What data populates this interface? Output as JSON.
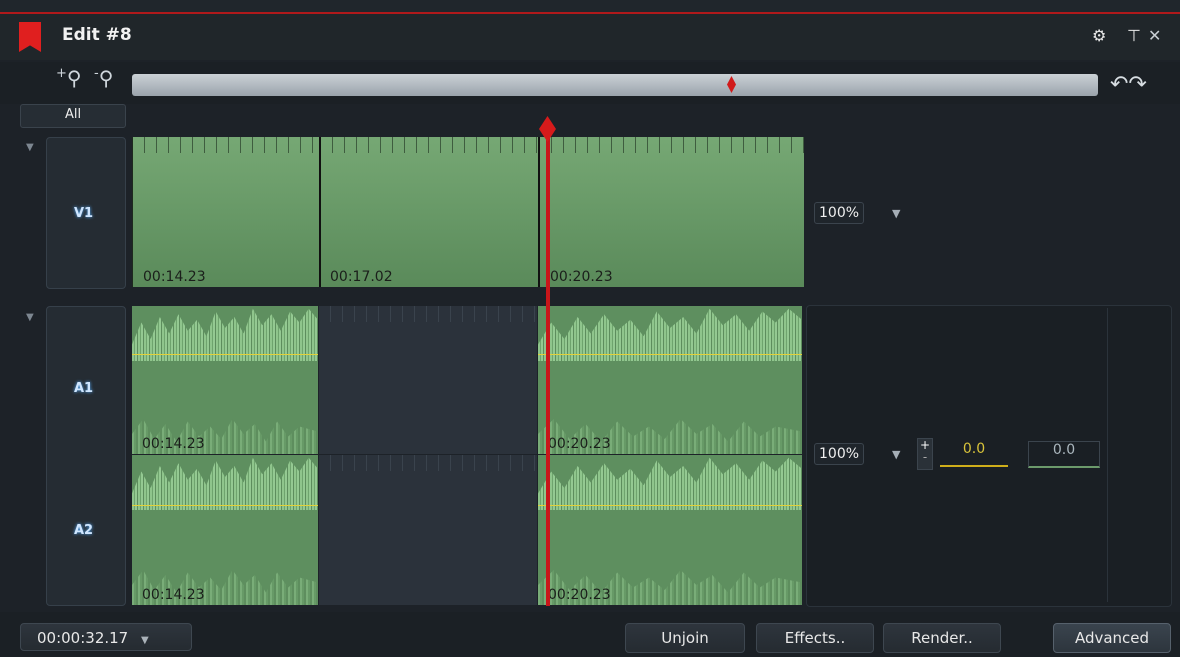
{
  "window": {
    "title": "Edit #8"
  },
  "titlebar_icons": [
    "gears-icon",
    "pin-icon",
    "close-icon"
  ],
  "zoom": {
    "in_label": "+",
    "out_label": "-",
    "all_label": "All"
  },
  "tracks": [
    {
      "name": "V1",
      "timecodes": [
        "00:14.23",
        "00:17.02",
        "00:20.23"
      ],
      "opacity": "100%"
    },
    {
      "name": "A1",
      "timecodes": [
        "00:14.23",
        "00:20.23"
      ],
      "volume": "100%"
    },
    {
      "name": "A2",
      "timecodes": [
        "00:14.23",
        "00:20.23"
      ]
    }
  ],
  "audio_controls": {
    "plus": "+",
    "minus": "-",
    "gain_a": "0.0",
    "gain_b": "0.0"
  },
  "footer": {
    "duration": "00:00:32.17",
    "buttons": {
      "unjoin": "Unjoin",
      "effects": "Effects..",
      "render": "Render..",
      "advanced": "Advanced"
    }
  },
  "colors": {
    "accent": "#d11b1b",
    "clip": "#6f9d6e",
    "volume_line": "#e2d13a"
  }
}
